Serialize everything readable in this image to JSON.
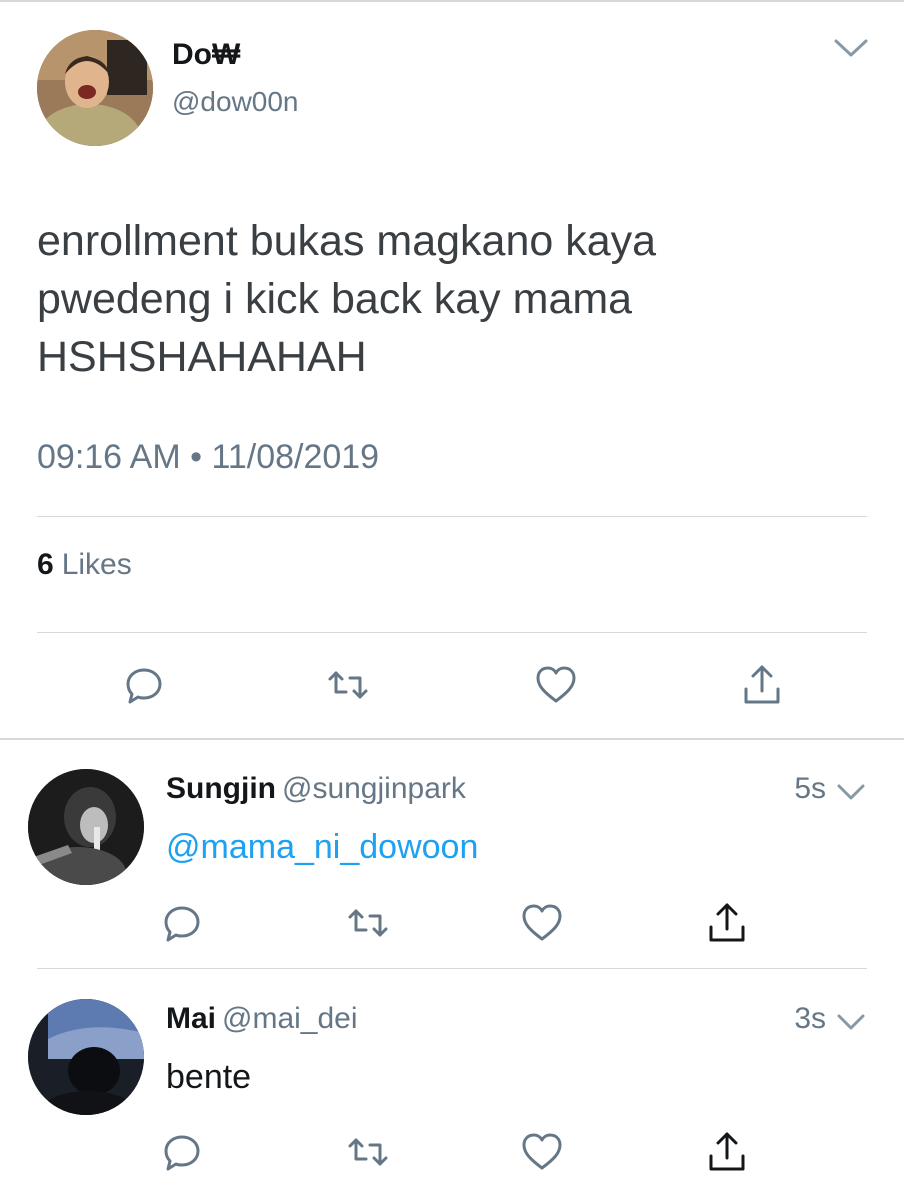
{
  "main_tweet": {
    "author_name": "Do₩",
    "handle": "@dow00n",
    "text_lines": [
      "enrollment bukas magkano kaya",
      "pwedeng i kick back kay mama",
      "HSHSHAHAHAH"
    ],
    "timestamp": "09:16 AM • 11/08/2019",
    "likes_count": "6",
    "likes_label": "Likes"
  },
  "replies": [
    {
      "name": "Sungjin",
      "handle": "@sungjinpark",
      "time": "5s",
      "text": "@mama_ni_dowoon"
    },
    {
      "name": "Mai",
      "handle": "@mai_dei",
      "time": "3s",
      "text": "bente"
    }
  ],
  "icons": {
    "reply": "reply-icon",
    "retweet": "retweet-icon",
    "like": "heart-icon",
    "share": "share-icon",
    "menu": "chevron-down-icon"
  },
  "colors": {
    "icon_gray": "#657786",
    "link_blue": "#1da1f2",
    "divider": "#d6d9db"
  }
}
